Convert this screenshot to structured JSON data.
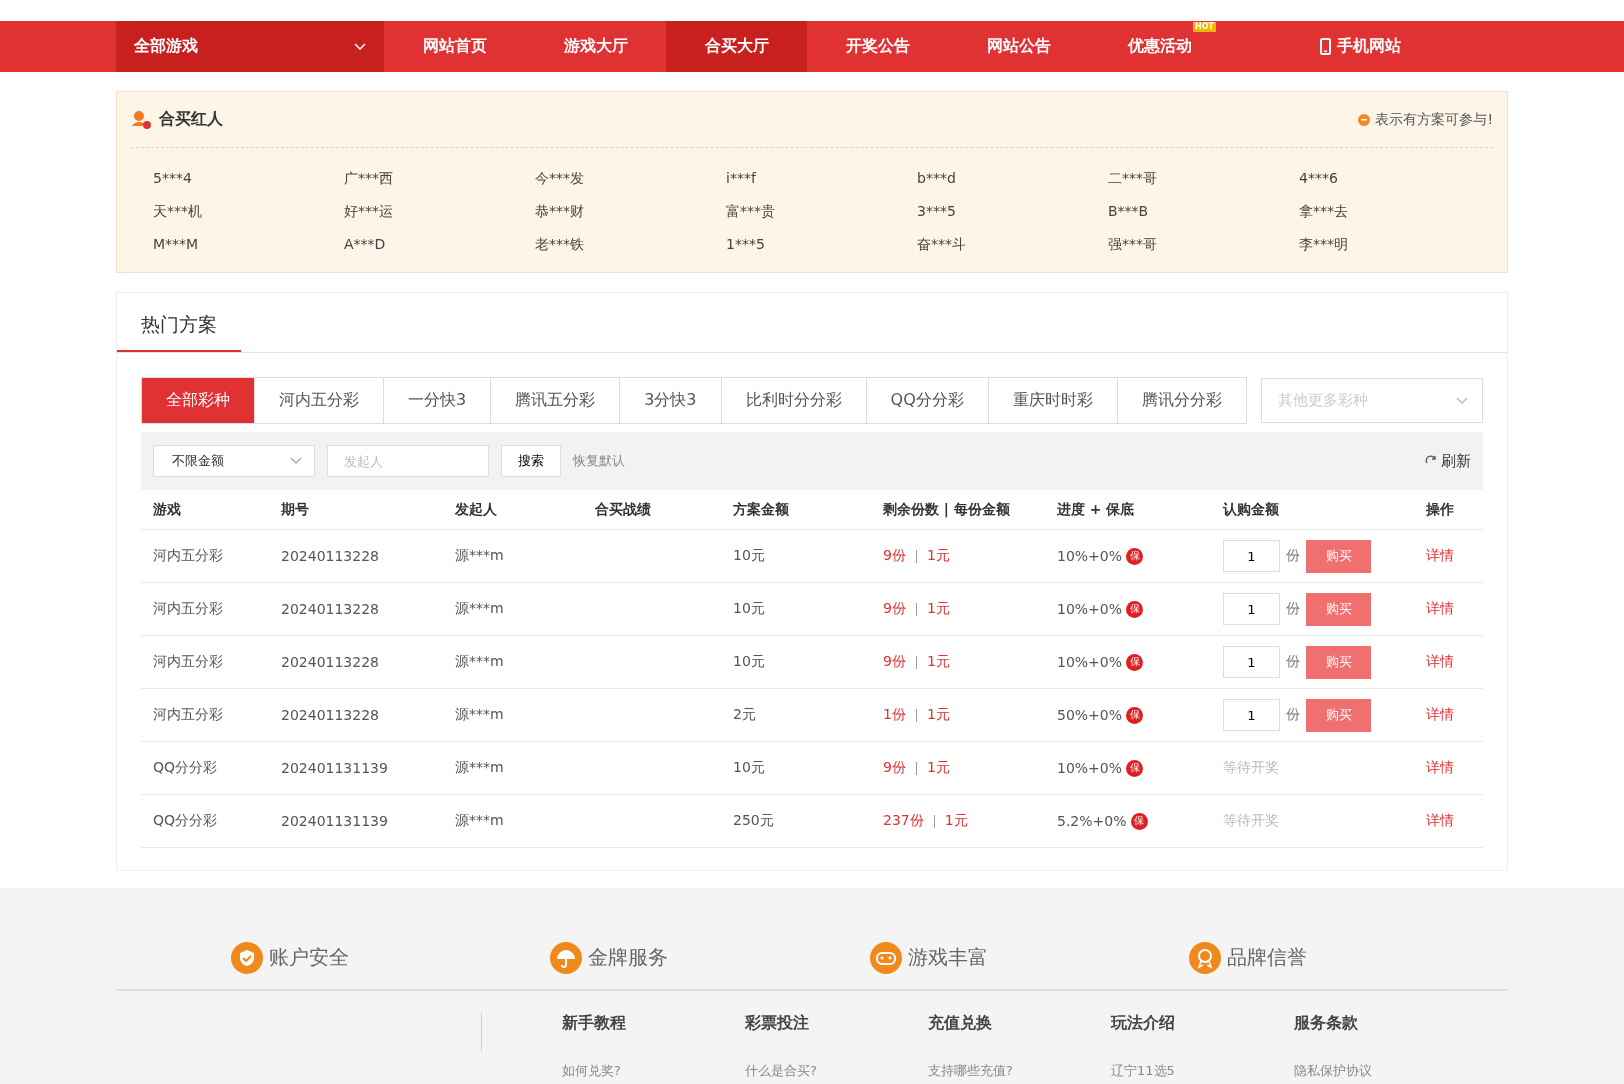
{
  "nav": {
    "dropdown": "全部游戏",
    "items": [
      {
        "label": "网站首页",
        "selected": false,
        "kind": "link"
      },
      {
        "label": "游戏大厅",
        "selected": false,
        "kind": "link"
      },
      {
        "label": "合买大厅",
        "selected": true,
        "kind": "link"
      },
      {
        "label": "开奖公告",
        "selected": false,
        "kind": "link"
      },
      {
        "label": "网站公告",
        "selected": false,
        "kind": "link"
      },
      {
        "label": "优惠活动",
        "selected": false,
        "kind": "link",
        "badge": "HOT"
      },
      {
        "label": "手机网站",
        "selected": false,
        "kind": "mobile"
      }
    ]
  },
  "hot_users": {
    "title": "合买红人",
    "legend": "表示有方案可参与!",
    "names": [
      "5***4",
      "广***西",
      "今***发",
      "i***f",
      "b***d",
      "二***哥",
      "4***6",
      "天***机",
      "好***运",
      "恭***财",
      "富***贵",
      "3***5",
      "B***B",
      "拿***去",
      "M***M",
      "A***D",
      "老***铁",
      "1***5",
      "奋***斗",
      "强***哥",
      "李***明"
    ]
  },
  "plans": {
    "title": "热门方案",
    "tabs": [
      {
        "label": "全部彩种",
        "selected": true
      },
      {
        "label": "河内五分彩",
        "selected": false
      },
      {
        "label": "一分快3",
        "selected": false
      },
      {
        "label": "腾讯五分彩",
        "selected": false
      },
      {
        "label": "3分快3",
        "selected": false
      },
      {
        "label": "比利时分分彩",
        "selected": false
      },
      {
        "label": "QQ分分彩",
        "selected": false
      },
      {
        "label": "重庆时时彩",
        "selected": false
      },
      {
        "label": "腾讯分分彩",
        "selected": false
      }
    ],
    "more_select": {
      "placeholder": "其他更多彩种"
    },
    "filter": {
      "amount": "不限金额",
      "initiator_placeholder": "发起人",
      "search": "搜索",
      "reset": "恢复默认",
      "refresh": "刷新"
    },
    "columns": [
      "游戏",
      "期号",
      "发起人",
      "合买战绩",
      "方案金额",
      "剩余份数 | 每份金额",
      "进度 + 保底",
      "认购金额",
      "操作"
    ],
    "rows": [
      {
        "game": "河内五分彩",
        "issue": "20240113228",
        "initiator": "源***m",
        "amount": "10元",
        "remaining": "9份",
        "per_share": "1元",
        "progress": "10%+0%",
        "guarantee": "保",
        "subscribe": {
          "kind": "buy",
          "qty": "1",
          "unit": "份",
          "button": "购买"
        },
        "action": "详情"
      },
      {
        "game": "河内五分彩",
        "issue": "20240113228",
        "initiator": "源***m",
        "amount": "10元",
        "remaining": "9份",
        "per_share": "1元",
        "progress": "10%+0%",
        "guarantee": "保",
        "subscribe": {
          "kind": "buy",
          "qty": "1",
          "unit": "份",
          "button": "购买"
        },
        "action": "详情"
      },
      {
        "game": "河内五分彩",
        "issue": "20240113228",
        "initiator": "源***m",
        "amount": "10元",
        "remaining": "9份",
        "per_share": "1元",
        "progress": "10%+0%",
        "guarantee": "保",
        "subscribe": {
          "kind": "buy",
          "qty": "1",
          "unit": "份",
          "button": "购买"
        },
        "action": "详情"
      },
      {
        "game": "河内五分彩",
        "issue": "20240113228",
        "initiator": "源***m",
        "amount": "2元",
        "remaining": "1份",
        "per_share": "1元",
        "progress": "50%+0%",
        "guarantee": "保",
        "subscribe": {
          "kind": "buy",
          "qty": "1",
          "unit": "份",
          "button": "购买"
        },
        "action": "详情"
      },
      {
        "game": "QQ分分彩",
        "issue": "202401131139",
        "initiator": "源***m",
        "amount": "10元",
        "remaining": "9份",
        "per_share": "1元",
        "progress": "10%+0%",
        "guarantee": "保",
        "subscribe": {
          "kind": "status",
          "text": "等待开奖"
        },
        "action": "详情"
      },
      {
        "game": "QQ分分彩",
        "issue": "202401131139",
        "initiator": "源***m",
        "amount": "250元",
        "remaining": "237份",
        "per_share": "1元",
        "progress": "5.2%+0%",
        "guarantee": "保",
        "subscribe": {
          "kind": "status",
          "text": "等待开奖"
        },
        "action": "详情"
      }
    ]
  },
  "footer": {
    "features": [
      {
        "label": "账户安全",
        "kind": "shield"
      },
      {
        "label": "金牌服务",
        "kind": "umbrella"
      },
      {
        "label": "游戏丰富",
        "kind": "gamepad"
      },
      {
        "label": "品牌信誉",
        "kind": "medal"
      }
    ],
    "links": [
      {
        "title": "新手教程",
        "items": [
          "如何兑奖?"
        ]
      },
      {
        "title": "彩票投注",
        "items": [
          "什么是合买?"
        ]
      },
      {
        "title": "充值兑换",
        "items": [
          "支持哪些充值?"
        ]
      },
      {
        "title": "玩法介绍",
        "items": [
          "辽宁11选5"
        ]
      },
      {
        "title": "服务条款",
        "items": [
          "隐私保护协议"
        ]
      }
    ]
  }
}
